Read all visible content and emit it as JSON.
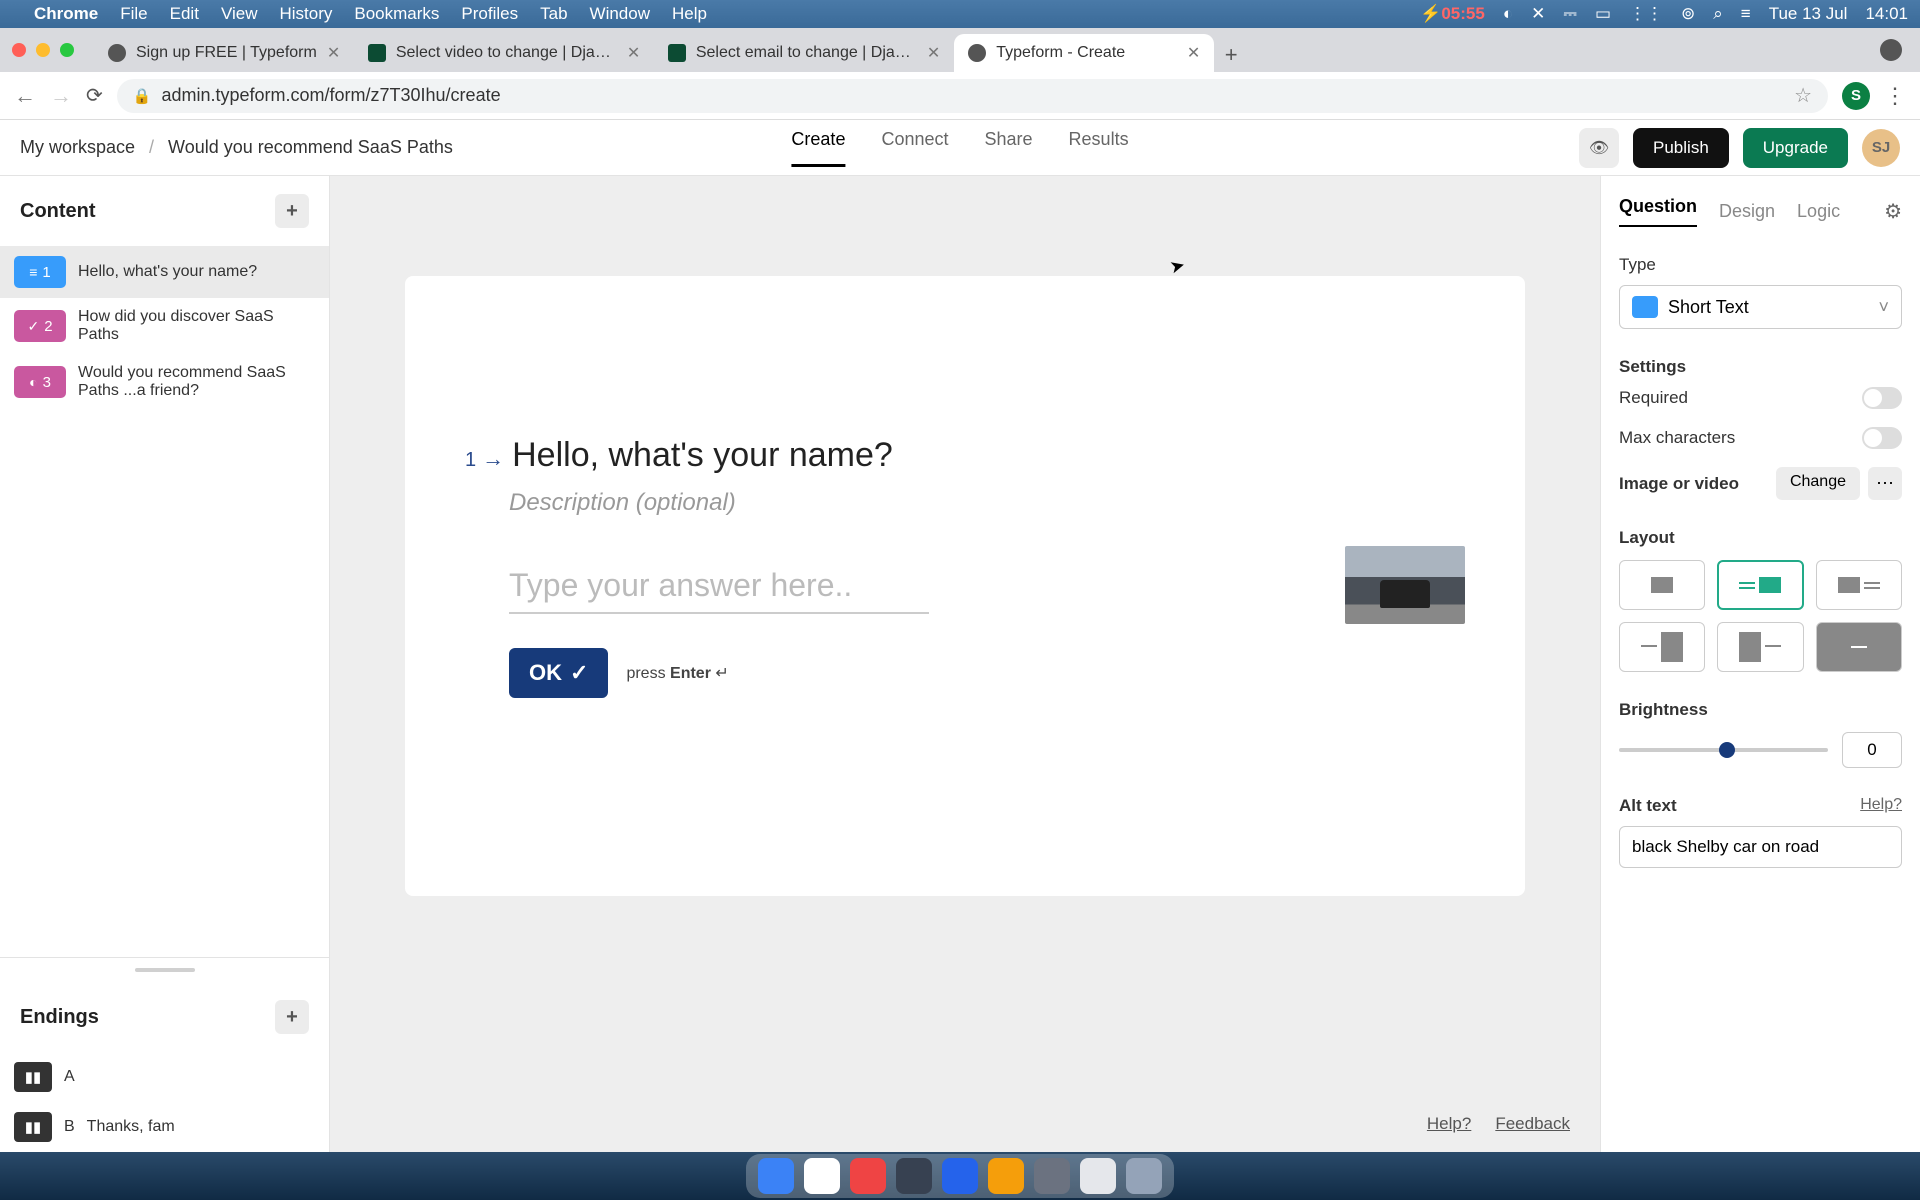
{
  "menubar": {
    "app": "Chrome",
    "items": [
      "File",
      "Edit",
      "View",
      "History",
      "Bookmarks",
      "Profiles",
      "Tab",
      "Window",
      "Help"
    ],
    "battery": "05:55",
    "date": "Tue 13 Jul",
    "time": "14:01"
  },
  "tabs": [
    {
      "title": "Sign up FREE | Typeform",
      "active": false,
      "favicon": "dark"
    },
    {
      "title": "Select video to change | Django",
      "active": false,
      "favicon": "django"
    },
    {
      "title": "Select email to change | Django",
      "active": false,
      "favicon": "django"
    },
    {
      "title": "Typeform - Create",
      "active": true,
      "favicon": "dark"
    }
  ],
  "url": "admin.typeform.com/form/z7T30Ihu/create",
  "addr_avatar": "S",
  "header": {
    "workspace": "My workspace",
    "form_title": "Would you recommend SaaS Paths",
    "nav": [
      "Create",
      "Connect",
      "Share",
      "Results"
    ],
    "active_nav": 0,
    "publish": "Publish",
    "upgrade": "Upgrade",
    "avatar": "SJ"
  },
  "left": {
    "content_title": "Content",
    "questions": [
      {
        "num": "1",
        "type": "short-text",
        "color": "blue",
        "label": "Hello, what's your name?"
      },
      {
        "num": "2",
        "type": "multiple",
        "color": "magenta",
        "label": "How did you discover SaaS Paths"
      },
      {
        "num": "3",
        "type": "opinion",
        "color": "magenta",
        "label": "Would you recommend SaaS Paths ...a friend?"
      }
    ],
    "endings_title": "Endings",
    "endings": [
      {
        "letter": "A",
        "label": ""
      },
      {
        "letter": "B",
        "label": "Thanks, fam"
      }
    ]
  },
  "canvas": {
    "q_number": "1",
    "q_title": "Hello, what's your name?",
    "description_placeholder": "Description (optional)",
    "answer_placeholder": "Type your answer here..",
    "ok": "OK",
    "press": "press",
    "enter": "Enter",
    "help": "Help?",
    "feedback": "Feedback"
  },
  "right": {
    "tabs": [
      "Question",
      "Design",
      "Logic"
    ],
    "active_tab": 0,
    "type_label": "Type",
    "type_value": "Short Text",
    "settings_label": "Settings",
    "required": "Required",
    "max_chars": "Max characters",
    "image_label": "Image or video",
    "change": "Change",
    "layout_label": "Layout",
    "brightness_label": "Brightness",
    "brightness_value": "0",
    "alt_label": "Alt text",
    "alt_help": "Help?",
    "alt_value": "black Shelby car on road"
  }
}
